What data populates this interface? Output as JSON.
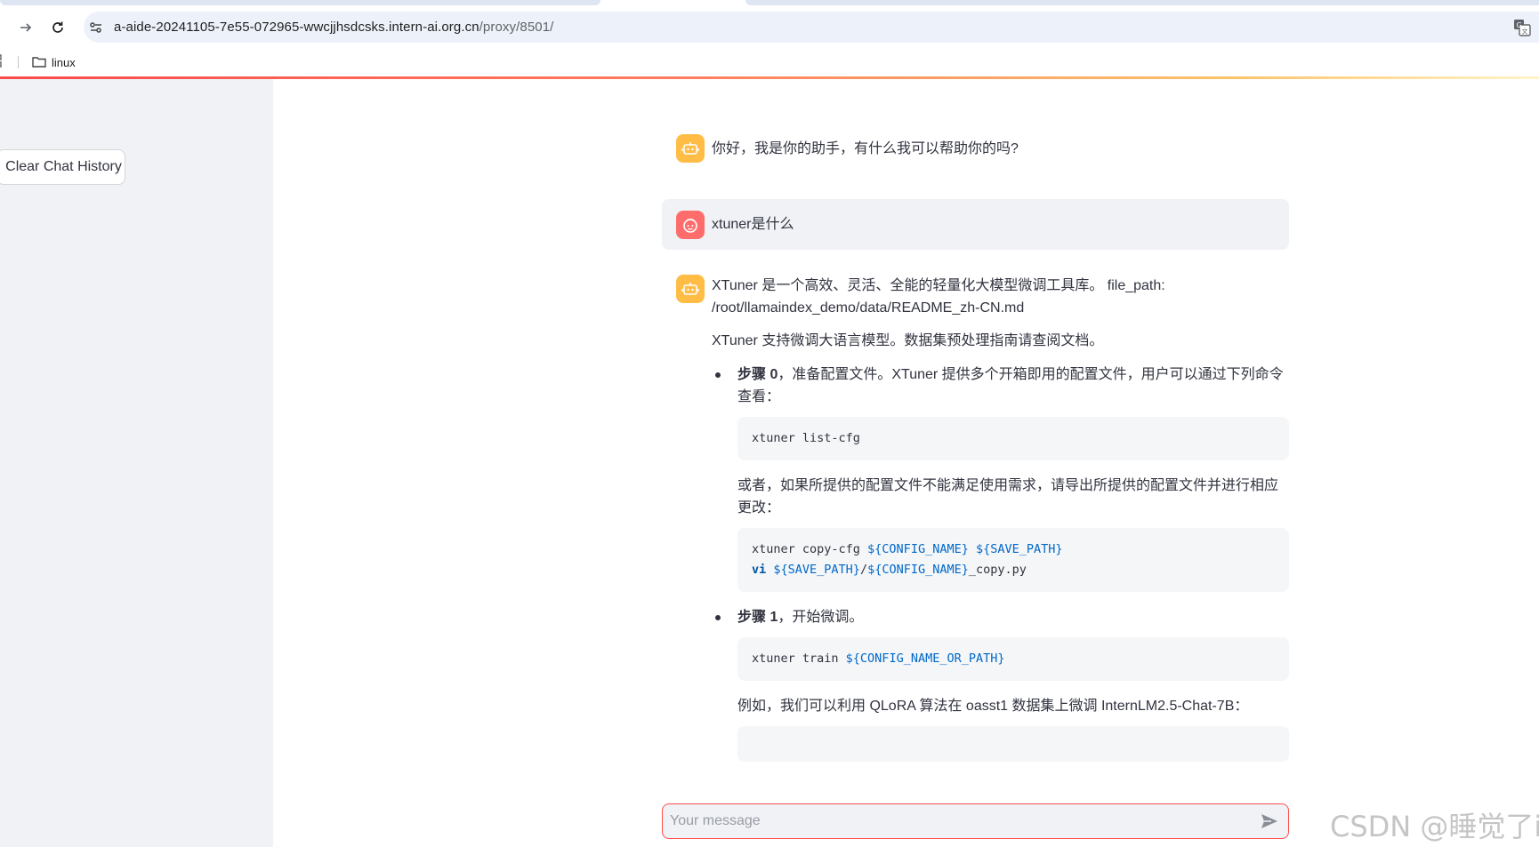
{
  "browser": {
    "url_host": "a-aide-20241105-7e55-072965-wwcjjhsdcsks.intern-ai.org.cn",
    "url_path": "/proxy/8501/",
    "bookmark_folder": "linux"
  },
  "sidebar": {
    "clear_button_label": "Clear Chat History"
  },
  "chat": {
    "greeting": "你好，我是你的助手，有什么我可以帮助你的吗?",
    "user_question": "xtuner是什么",
    "answer": {
      "intro_line1": "XTuner 是一个高效、灵活、全能的轻量化大模型微调工具库。 file_path:",
      "intro_line2": "/root/llamaindex_demo/data/README_zh-CN.md",
      "support": "XTuner 支持微调大语言模型。数据集预处理指南请查阅文档。",
      "step0_label": "步骤 0",
      "step0_text": "，准备配置文件。XTuner 提供多个开箱即用的配置文件，用户可以通过下列命令查看：",
      "code1": "xtuner list-cfg",
      "step0_alt": "或者，如果所提供的配置文件不能满足使用需求，请导出所提供的配置文件并进行相应更改：",
      "code2_line1_cmd": "xtuner copy-cfg ",
      "code2_line1_var1": "${CONFIG_NAME}",
      "code2_line1_var2": "${SAVE_PATH}",
      "code2_line2_kw": "vi",
      "code2_line2_var1": "${SAVE_PATH}",
      "code2_line2_slash": "/",
      "code2_line2_var2": "${CONFIG_NAME}",
      "code2_line2_suffix": "_copy.py",
      "step1_label": "步骤 1",
      "step1_text": "，开始微调。",
      "code3_cmd": "xtuner train ",
      "code3_var": "${CONFIG_NAME_OR_PATH}",
      "example": "例如，我们可以利用 QLoRA 算法在 oasst1 数据集上微调 InternLM2.5-Chat-7B："
    }
  },
  "input": {
    "placeholder": "Your message"
  },
  "watermark": "CSDN @睡觉了i"
}
